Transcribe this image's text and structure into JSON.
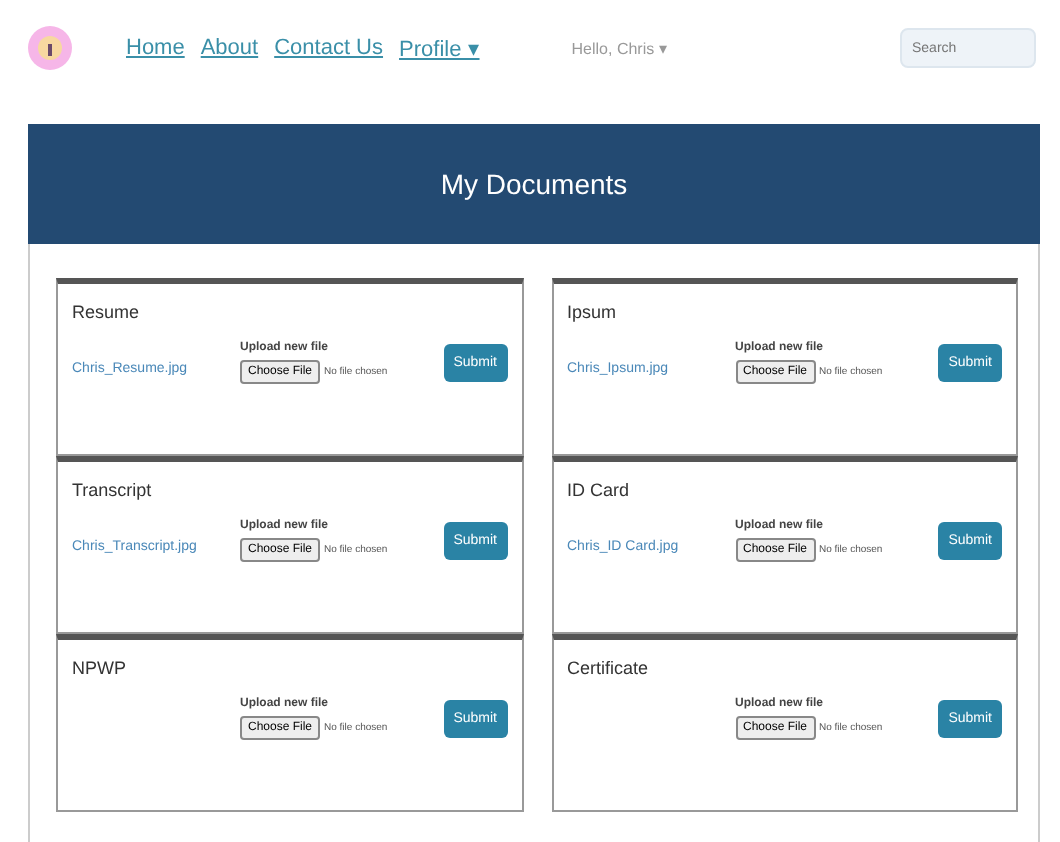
{
  "nav": {
    "links": [
      {
        "label": "Home",
        "kind": "link"
      },
      {
        "label": "About",
        "kind": "link"
      },
      {
        "label": "Contact Us",
        "kind": "link"
      },
      {
        "label": "Profile ▾",
        "kind": "link"
      }
    ],
    "greeting": "Hello, Chris ▾",
    "search": {
      "placeholder": "Search"
    }
  },
  "panel": {
    "title": "My Documents"
  },
  "documents": [
    {
      "title": "Resume",
      "file": "Chris_Resume.jpg",
      "upload_label": "Upload new file",
      "choose": "Choose File",
      "chosen": "No file chosen",
      "submit": "Submit"
    },
    {
      "title": "Ipsum",
      "file": "Chris_Ipsum.jpg",
      "upload_label": "Upload new file",
      "choose": "Choose File",
      "chosen": "No file chosen",
      "submit": "Submit"
    },
    {
      "title": "Transcript",
      "file": "Chris_Transcript.jpg",
      "upload_label": "Upload new file",
      "choose": "Choose File",
      "chosen": "No file chosen",
      "submit": "Submit"
    },
    {
      "title": "ID Card",
      "file": "Chris_ID Card.jpg",
      "upload_label": "Upload new file",
      "choose": "Choose File",
      "chosen": "No file chosen",
      "submit": "Submit"
    },
    {
      "title": "NPWP",
      "upload_label": "Upload new file",
      "choose": "Choose File",
      "chosen": "No file chosen",
      "submit": "Submit"
    },
    {
      "title": "Certificate",
      "upload_label": "Upload new file",
      "choose": "Choose File",
      "chosen": "No file chosen",
      "submit": "Submit"
    }
  ]
}
